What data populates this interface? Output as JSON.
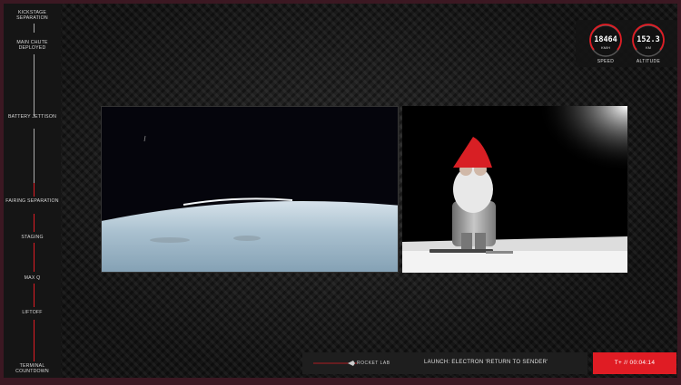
{
  "timeline": {
    "milestones": [
      {
        "label": "KICKSTAGE SEPARATION"
      },
      {
        "label": "MAIN CHUTE DEPLOYED"
      },
      {
        "label": "BATTERY JETTISON"
      },
      {
        "label": "FAIRING SEPARATION"
      },
      {
        "label": "STAGING"
      },
      {
        "label": "MAX Q"
      },
      {
        "label": "LIFTOFF"
      },
      {
        "label": "TERMINAL COUNTDOWN"
      }
    ],
    "active_color": "#e01c24"
  },
  "telemetry": {
    "speed": {
      "value": "18464",
      "unit": "KM/H",
      "caption": "SPEED"
    },
    "altitude": {
      "value": "152.3",
      "unit": "KM",
      "caption": "ALTITUDE"
    }
  },
  "lower_bar": {
    "logo": "ROCKET LAB",
    "mission": "LAUNCH: ELECTRON 'RETURN TO SENDER'"
  },
  "clock": "T+ // 00:04:14",
  "colors": {
    "accent": "#e01c24",
    "background": "#3b1822"
  },
  "feeds": [
    {
      "icon": "earth-horizon-camera-feed"
    },
    {
      "icon": "gnome-payload-camera-feed"
    }
  ]
}
